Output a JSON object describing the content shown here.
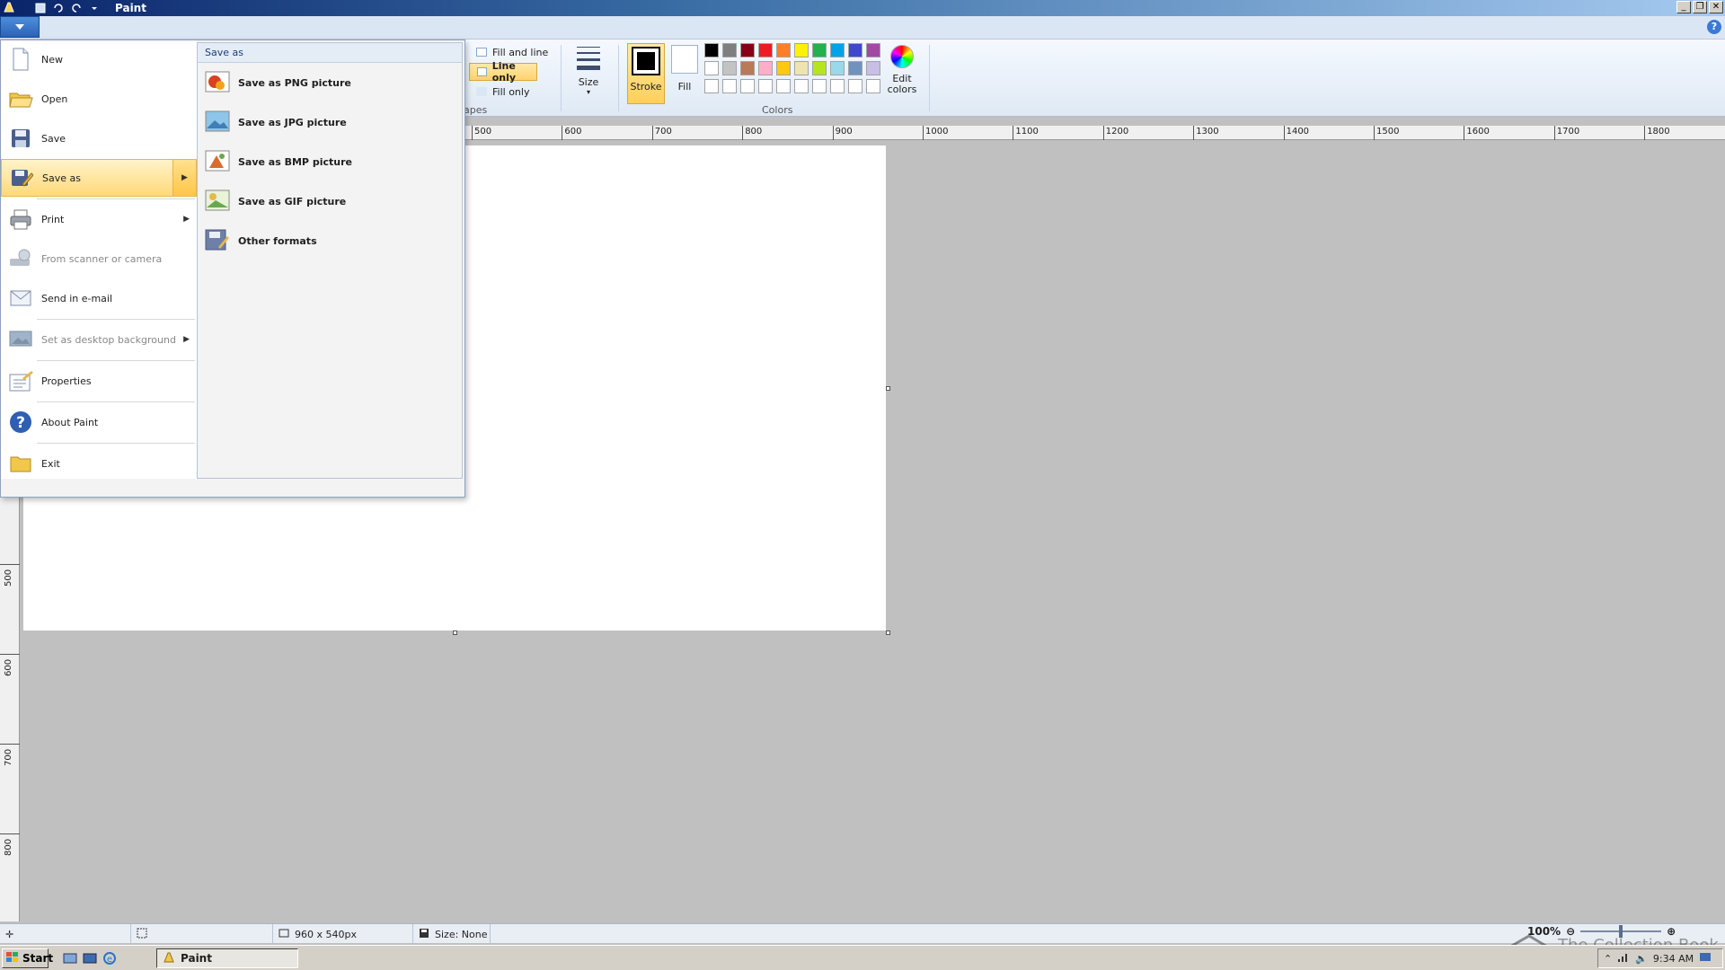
{
  "window": {
    "title": "Paint"
  },
  "ribbon": {
    "shape_fill_options": [
      {
        "label": "Fill and line",
        "active": false
      },
      {
        "label": "Line only",
        "active": true
      },
      {
        "label": "Fill only",
        "active": false
      }
    ],
    "shapes_group_label": "apes",
    "size_label": "Size",
    "stroke_label": "Stroke",
    "fill_label": "Fill",
    "colors_group_label": "Colors",
    "edit_colors_line1": "Edit",
    "edit_colors_line2": "colors",
    "palette": [
      "#000000",
      "#7f7f7f",
      "#880015",
      "#ed1c24",
      "#ff7f27",
      "#fff200",
      "#22b14c",
      "#00a2e8",
      "#3f48cc",
      "#a349a4",
      "#ffffff",
      "#c3c3c3",
      "#b97a57",
      "#ffaec9",
      "#ffc90e",
      "#efe4b0",
      "#b5e61d",
      "#99d9ea",
      "#7092be",
      "#c8bfe7",
      "#ffffff",
      "#ffffff",
      "#ffffff",
      "#ffffff",
      "#ffffff",
      "#ffffff",
      "#ffffff",
      "#ffffff",
      "#ffffff",
      "#ffffff"
    ]
  },
  "ruler": {
    "h_labels": [
      "500",
      "600",
      "700",
      "800",
      "900",
      "1000",
      "1100",
      "1200",
      "1300",
      "1400",
      "1500",
      "1600",
      "1700",
      "1800"
    ],
    "v_labels": [
      "500",
      "600",
      "700",
      "800"
    ]
  },
  "app_menu": {
    "items": [
      {
        "label": "New",
        "icon": "new-document-icon",
        "disabled": false,
        "submenu": false,
        "selected": false
      },
      {
        "label": "Open",
        "icon": "open-folder-icon",
        "disabled": false,
        "submenu": false,
        "selected": false
      },
      {
        "label": "Save",
        "icon": "floppy-disk-icon",
        "disabled": false,
        "submenu": false,
        "selected": false
      },
      {
        "label": "Save as",
        "icon": "save-as-icon",
        "disabled": false,
        "submenu": true,
        "selected": true
      },
      {
        "label": "Print",
        "icon": "printer-icon",
        "disabled": false,
        "submenu": true,
        "selected": false
      },
      {
        "label": "From scanner or camera",
        "icon": "scanner-icon",
        "disabled": true,
        "submenu": false,
        "selected": false
      },
      {
        "label": "Send in e-mail",
        "icon": "email-icon",
        "disabled": false,
        "submenu": false,
        "selected": false
      },
      {
        "label": "Set as desktop background",
        "icon": "desktop-background-icon",
        "disabled": true,
        "submenu": true,
        "selected": false
      },
      {
        "label": "Properties",
        "icon": "properties-icon",
        "disabled": false,
        "submenu": false,
        "selected": false
      },
      {
        "label": "About Paint",
        "icon": "help-question-icon",
        "disabled": false,
        "submenu": false,
        "selected": false
      },
      {
        "label": "Exit",
        "icon": "exit-folder-icon",
        "disabled": false,
        "submenu": false,
        "selected": false
      }
    ],
    "submenu_title": "Save as",
    "submenu_items": [
      {
        "label": "Save as PNG picture",
        "icon": "png-picture-icon"
      },
      {
        "label": "Save as JPG picture",
        "icon": "jpg-picture-icon"
      },
      {
        "label": "Save as BMP picture",
        "icon": "bmp-picture-icon"
      },
      {
        "label": "Save as GIF picture",
        "icon": "gif-picture-icon"
      },
      {
        "label": "Other formats",
        "icon": "other-formats-icon"
      }
    ]
  },
  "statusbar": {
    "canvas_size": "960 x 540px",
    "selection_size": "Size: None",
    "zoom": "100%"
  },
  "taskbar": {
    "start_label": "Start",
    "task_label": "Paint",
    "clock": "9:34 AM"
  },
  "watermark": {
    "text": "The Collection Book"
  }
}
